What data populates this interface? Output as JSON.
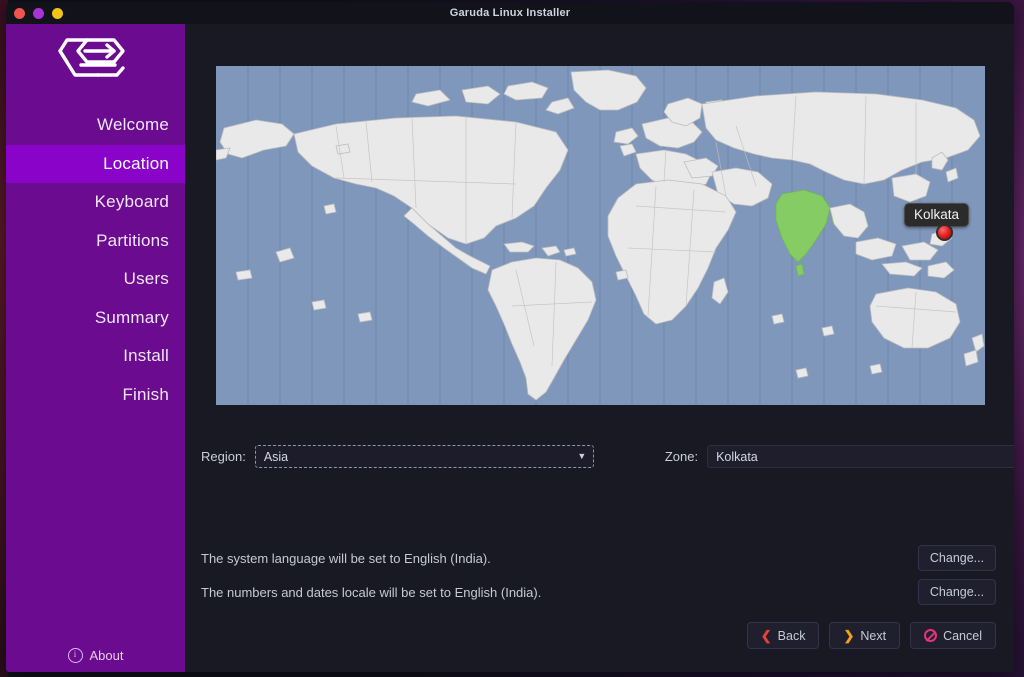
{
  "window": {
    "title": "Garuda Linux Installer",
    "controls": [
      {
        "name": "close",
        "color": "#f0544f"
      },
      {
        "name": "minimize",
        "color": "#a833d6"
      },
      {
        "name": "maximize",
        "color": "#f0c419"
      }
    ]
  },
  "sidebar": {
    "logo": "garuda-eagle-logo",
    "background": "#6b0b8f",
    "active_background": "#8a03c9",
    "items": [
      {
        "label": "Welcome",
        "active": false
      },
      {
        "label": "Location",
        "active": true
      },
      {
        "label": "Keyboard",
        "active": false
      },
      {
        "label": "Partitions",
        "active": false
      },
      {
        "label": "Users",
        "active": false
      },
      {
        "label": "Summary",
        "active": false
      },
      {
        "label": "Install",
        "active": false
      },
      {
        "label": "Finish",
        "active": false
      }
    ],
    "about": {
      "label": "About",
      "icon": "info-icon"
    }
  },
  "map": {
    "tooltip": "Kolkata",
    "marker": {
      "color": "#e01a1a",
      "outline": "#2f2f2f"
    },
    "ocean_color": "#8097bc",
    "land_color": "#e9e9e9",
    "border_color": "#b9b9b9",
    "highlight_country": "India",
    "highlight_color": "#85cc64",
    "timezone_line_color": "#7087ac"
  },
  "selectors": {
    "region": {
      "label": "Region:",
      "value": "Asia",
      "focused": true,
      "arrow": "chevron-down-icon"
    },
    "zone": {
      "label": "Zone:",
      "value": "Kolkata",
      "focused": false,
      "arrow": "chevron-down-icon"
    }
  },
  "locale": {
    "rows": [
      {
        "text": "The system language will be set to English (India).",
        "button": "Change..."
      },
      {
        "text": "The numbers and dates locale will be set to English (India).",
        "button": "Change..."
      }
    ]
  },
  "footer": {
    "back": {
      "label": "Back",
      "icon": "chevron-left-icon",
      "color": "#e8413a"
    },
    "next": {
      "label": "Next",
      "icon": "chevron-right-icon",
      "color": "#f5a01b"
    },
    "cancel": {
      "label": "Cancel",
      "icon": "ban-icon",
      "color": "#e5337e"
    }
  }
}
